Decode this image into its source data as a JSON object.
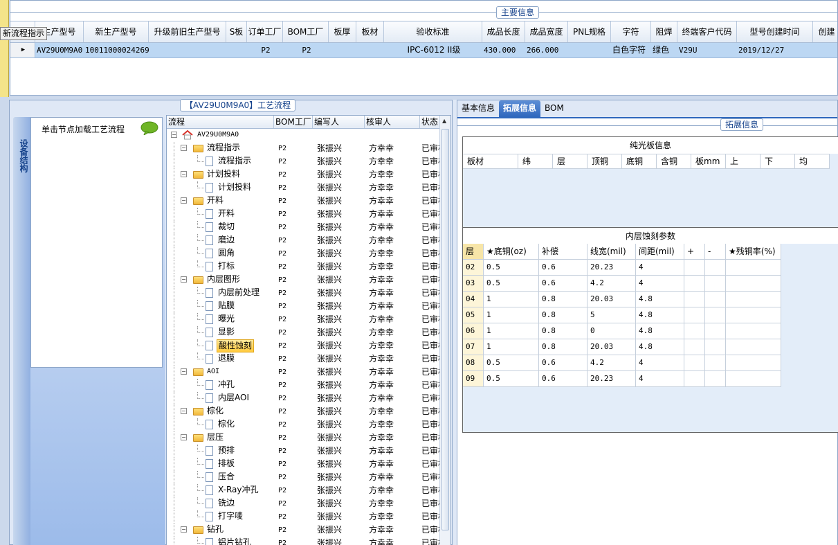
{
  "tooltip": "新流程指示",
  "main_info": {
    "title": "主要信息",
    "columns": [
      "生产型号",
      "新生产型号",
      "升级前旧生产型号",
      "S板",
      "订单工厂",
      "BOM工厂",
      "板厚",
      "板材",
      "验收标准",
      "成品长度",
      "成品宽度",
      "PNL规格",
      "字符",
      "阻焊",
      "终端客户代码",
      "型号创建时间",
      "创建"
    ],
    "row": [
      "AV29U0M9A0",
      "10011000024269",
      "",
      "",
      "P2",
      "P2",
      "",
      "",
      "IPC-6012 II级",
      "430.000",
      "266.000",
      "",
      "白色字符",
      "绿色",
      "V29U",
      "2019/12/27",
      ""
    ]
  },
  "flow": {
    "title": "【AV29U0M9A0】工艺流程",
    "side_tab": "设备结构",
    "node_hint": "单击节点加载工艺流程",
    "columns": [
      "流程",
      "BOM工厂",
      "编写人",
      "核审人",
      "状态"
    ],
    "root": "AV29U0M9A0",
    "rows": [
      {
        "name": "流程指示",
        "type": "folder",
        "bom": "P2",
        "writer": "张振兴",
        "reviewer": "方幸幸",
        "status": "已审核"
      },
      {
        "name": "流程指示",
        "type": "doc",
        "bom": "P2",
        "writer": "张振兴",
        "reviewer": "方幸幸",
        "status": "已审核"
      },
      {
        "name": "计划投料",
        "type": "folder",
        "bom": "P2",
        "writer": "张振兴",
        "reviewer": "方幸幸",
        "status": "已审核"
      },
      {
        "name": "计划投料",
        "type": "doc",
        "bom": "P2",
        "writer": "张振兴",
        "reviewer": "方幸幸",
        "status": "已审核"
      },
      {
        "name": "开料",
        "type": "folder",
        "bom": "P2",
        "writer": "张振兴",
        "reviewer": "方幸幸",
        "status": "已审核"
      },
      {
        "name": "开料",
        "type": "doc",
        "bom": "P2",
        "writer": "张振兴",
        "reviewer": "方幸幸",
        "status": "已审核"
      },
      {
        "name": "裁切",
        "type": "doc",
        "bom": "P2",
        "writer": "张振兴",
        "reviewer": "方幸幸",
        "status": "已审核"
      },
      {
        "name": "磨边",
        "type": "doc",
        "bom": "P2",
        "writer": "张振兴",
        "reviewer": "方幸幸",
        "status": "已审核"
      },
      {
        "name": "圆角",
        "type": "doc",
        "bom": "P2",
        "writer": "张振兴",
        "reviewer": "方幸幸",
        "status": "已审核"
      },
      {
        "name": "打标",
        "type": "doc",
        "bom": "P2",
        "writer": "张振兴",
        "reviewer": "方幸幸",
        "status": "已审核"
      },
      {
        "name": "内层图形",
        "type": "folder",
        "bom": "P2",
        "writer": "张振兴",
        "reviewer": "方幸幸",
        "status": "已审核"
      },
      {
        "name": "内层前处理",
        "type": "doc",
        "bom": "P2",
        "writer": "张振兴",
        "reviewer": "方幸幸",
        "status": "已审核"
      },
      {
        "name": "贴膜",
        "type": "doc",
        "bom": "P2",
        "writer": "张振兴",
        "reviewer": "方幸幸",
        "status": "已审核"
      },
      {
        "name": "曝光",
        "type": "doc",
        "bom": "P2",
        "writer": "张振兴",
        "reviewer": "方幸幸",
        "status": "已审核"
      },
      {
        "name": "显影",
        "type": "doc",
        "bom": "P2",
        "writer": "张振兴",
        "reviewer": "方幸幸",
        "status": "已审核"
      },
      {
        "name": "酸性蚀刻",
        "type": "doc",
        "bom": "P2",
        "writer": "张振兴",
        "reviewer": "方幸幸",
        "status": "已审核",
        "selected": true
      },
      {
        "name": "退膜",
        "type": "doc",
        "bom": "P2",
        "writer": "张振兴",
        "reviewer": "方幸幸",
        "status": "已审核"
      },
      {
        "name": "AOI",
        "type": "folder",
        "bom": "P2",
        "writer": "张振兴",
        "reviewer": "方幸幸",
        "status": "已审核"
      },
      {
        "name": "冲孔",
        "type": "doc",
        "bom": "P2",
        "writer": "张振兴",
        "reviewer": "方幸幸",
        "status": "已审核"
      },
      {
        "name": "内层AOI",
        "type": "doc",
        "bom": "P2",
        "writer": "张振兴",
        "reviewer": "方幸幸",
        "status": "已审核"
      },
      {
        "name": "棕化",
        "type": "folder",
        "bom": "P2",
        "writer": "张振兴",
        "reviewer": "方幸幸",
        "status": "已审核"
      },
      {
        "name": "棕化",
        "type": "doc",
        "bom": "P2",
        "writer": "张振兴",
        "reviewer": "方幸幸",
        "status": "已审核"
      },
      {
        "name": "层压",
        "type": "folder",
        "bom": "P2",
        "writer": "张振兴",
        "reviewer": "方幸幸",
        "status": "已审核"
      },
      {
        "name": "预排",
        "type": "doc",
        "bom": "P2",
        "writer": "张振兴",
        "reviewer": "方幸幸",
        "status": "已审核"
      },
      {
        "name": "排板",
        "type": "doc",
        "bom": "P2",
        "writer": "张振兴",
        "reviewer": "方幸幸",
        "status": "已审核"
      },
      {
        "name": "压合",
        "type": "doc",
        "bom": "P2",
        "writer": "张振兴",
        "reviewer": "方幸幸",
        "status": "已审核"
      },
      {
        "name": "X-Ray冲孔",
        "type": "doc",
        "bom": "P2",
        "writer": "张振兴",
        "reviewer": "方幸幸",
        "status": "已审核"
      },
      {
        "name": "铣边",
        "type": "doc",
        "bom": "P2",
        "writer": "张振兴",
        "reviewer": "方幸幸",
        "status": "已审核"
      },
      {
        "name": "打字唛",
        "type": "doc",
        "bom": "P2",
        "writer": "张振兴",
        "reviewer": "方幸幸",
        "status": "已审核"
      },
      {
        "name": "钻孔",
        "type": "folder",
        "bom": "P2",
        "writer": "张振兴",
        "reviewer": "方幸幸",
        "status": "已审核"
      },
      {
        "name": "铝片钻孔",
        "type": "doc",
        "bom": "P2",
        "writer": "张振兴",
        "reviewer": "方幸幸",
        "status": "已审核"
      }
    ]
  },
  "right": {
    "tabs": [
      "基本信息",
      "拓展信息",
      "BOM"
    ],
    "active_tab": 1,
    "ext_title": "拓展信息",
    "pure_title": "纯光板信息",
    "pure_columns": [
      "板材",
      "纬",
      "层",
      "顶铜",
      "底铜",
      "含铜",
      "板mm",
      "上",
      "下",
      "均"
    ],
    "etch_title": "内层蚀刻参数",
    "etch_columns": [
      "层",
      "★底铜(oz)",
      "补偿",
      "线宽(mil)",
      "间距(mil)",
      "+",
      "-",
      "★残铜率(%)"
    ],
    "etch_rows": [
      [
        "02",
        "0.5",
        "0.6",
        "20.23",
        "4",
        "",
        "",
        ""
      ],
      [
        "03",
        "0.5",
        "0.6",
        "4.2",
        "4",
        "",
        "",
        ""
      ],
      [
        "04",
        "1",
        "0.8",
        "20.03",
        "4.8",
        "",
        "",
        ""
      ],
      [
        "05",
        "1",
        "0.8",
        "5",
        "4.8",
        "",
        "",
        ""
      ],
      [
        "06",
        "1",
        "0.8",
        "0",
        "4.8",
        "",
        "",
        ""
      ],
      [
        "07",
        "1",
        "0.8",
        "20.03",
        "4.8",
        "",
        "",
        ""
      ],
      [
        "08",
        "0.5",
        "0.6",
        "4.2",
        "4",
        "",
        "",
        ""
      ],
      [
        "09",
        "0.5",
        "0.6",
        "20.23",
        "4",
        "",
        "",
        ""
      ]
    ]
  },
  "colors": {
    "accent": "#2f68bd",
    "selected_row": "#bcd7f3",
    "highlight": "#ffc93d"
  }
}
